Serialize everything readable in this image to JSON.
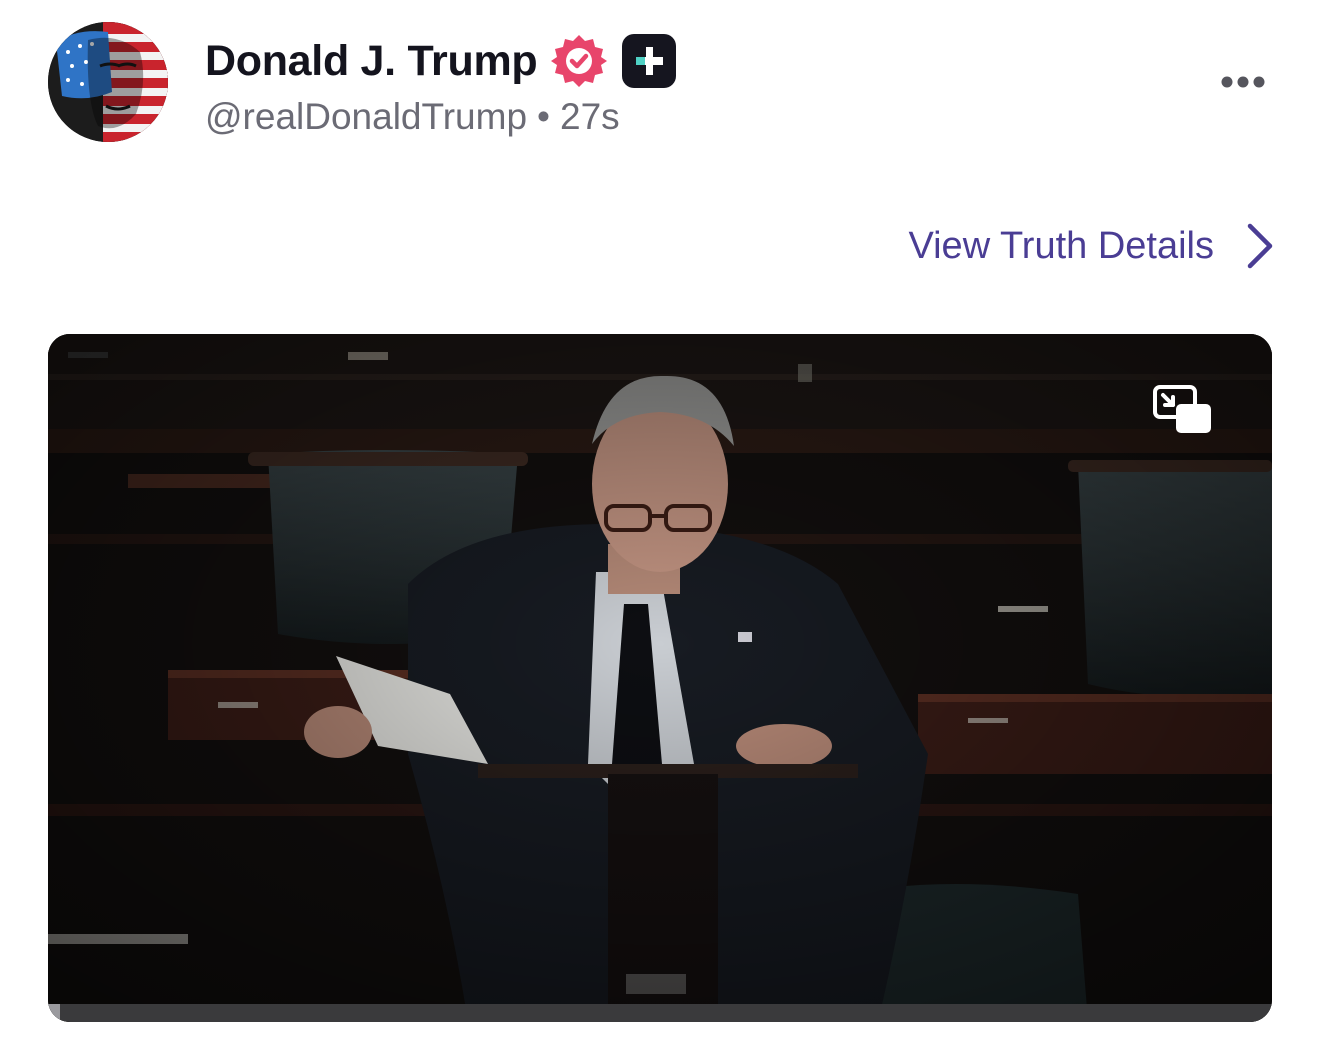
{
  "post": {
    "author": {
      "display_name": "Donald J. Trump",
      "handle": "@realDonaldTrump",
      "verified_icon": "verified-badge-icon",
      "plus_icon": "truth-plus-icon"
    },
    "separator": "•",
    "timestamp": "27s",
    "more_icon": "more-horizontal-icon",
    "details_link": {
      "label": "View Truth Details",
      "icon": "chevron-right-icon"
    },
    "media": {
      "type": "video",
      "pip_icon": "picture-in-picture-icon",
      "progress": 0.01
    }
  },
  "colors": {
    "name": "#14141e",
    "handle": "#6b6b75",
    "link_accent": "#4a3d94",
    "verified_badge": "#e8456b",
    "plus_badge_bg": "#15151f",
    "plus_badge_accent": "#4fd1c5"
  }
}
